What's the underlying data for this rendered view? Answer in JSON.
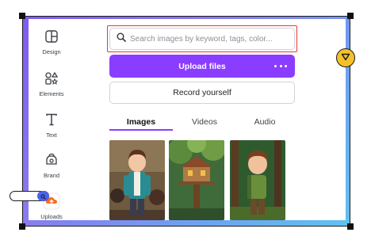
{
  "sidebar": {
    "items": [
      {
        "label": "Design",
        "icon": "design-icon"
      },
      {
        "label": "Elements",
        "icon": "elements-icon"
      },
      {
        "label": "Text",
        "icon": "text-icon"
      },
      {
        "label": "Brand",
        "icon": "brand-icon"
      },
      {
        "label": "Uploads",
        "icon": "uploads-icon"
      }
    ]
  },
  "search": {
    "placeholder": "Search images by keyword, tags, color...",
    "value": ""
  },
  "actions": {
    "upload_label": "Upload files",
    "record_label": "Record yourself"
  },
  "tabs": [
    {
      "label": "Images",
      "active": true
    },
    {
      "label": "Videos",
      "active": false
    },
    {
      "label": "Audio",
      "active": false
    }
  ],
  "gallery": [
    {
      "description": "cartoon boy in teal jacket"
    },
    {
      "description": "treehouse in forest"
    },
    {
      "description": "cartoon boy in forest"
    }
  ],
  "colors": {
    "accent": "#8b3dff",
    "highlight": "#e53935",
    "toggle": "#f5c12a"
  }
}
